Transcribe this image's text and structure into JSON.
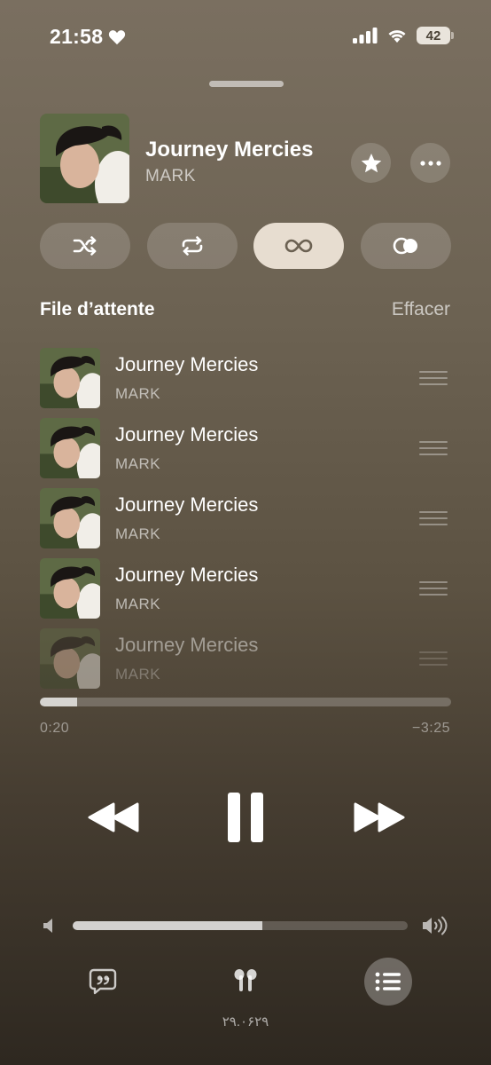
{
  "status_bar": {
    "time": "21:58",
    "battery": "42"
  },
  "now_playing": {
    "title": "Journey Mercies",
    "artist": "MARK",
    "favorite_icon": "star-icon",
    "more_icon": "ellipsis-icon"
  },
  "modes": [
    {
      "name": "shuffle",
      "icon": "shuffle-icon",
      "active": false
    },
    {
      "name": "repeat",
      "icon": "repeat-icon",
      "active": false
    },
    {
      "name": "autoplay",
      "icon": "infinity-icon",
      "active": true
    },
    {
      "name": "crossfade",
      "icon": "crossfade-icon",
      "active": false
    }
  ],
  "queue": {
    "title": "File d’attente",
    "clear_label": "Effacer",
    "items": [
      {
        "title": "Journey Mercies",
        "artist": "MARK"
      },
      {
        "title": "Journey Mercies",
        "artist": "MARK"
      },
      {
        "title": "Journey Mercies",
        "artist": "MARK"
      },
      {
        "title": "Journey Mercies",
        "artist": "MARK"
      },
      {
        "title": "Journey Mercies",
        "artist": "MARK"
      }
    ]
  },
  "playback": {
    "elapsed": "0:20",
    "remaining": "−3:25",
    "progress_fraction": 0.09,
    "volume_fraction": 0.565
  },
  "device_label": "۲۹.۰۶۲۹",
  "colors": {
    "active_pill": "#e7ddd0",
    "bg_top": "#7a6f60",
    "bg_bottom": "#2e2820"
  }
}
